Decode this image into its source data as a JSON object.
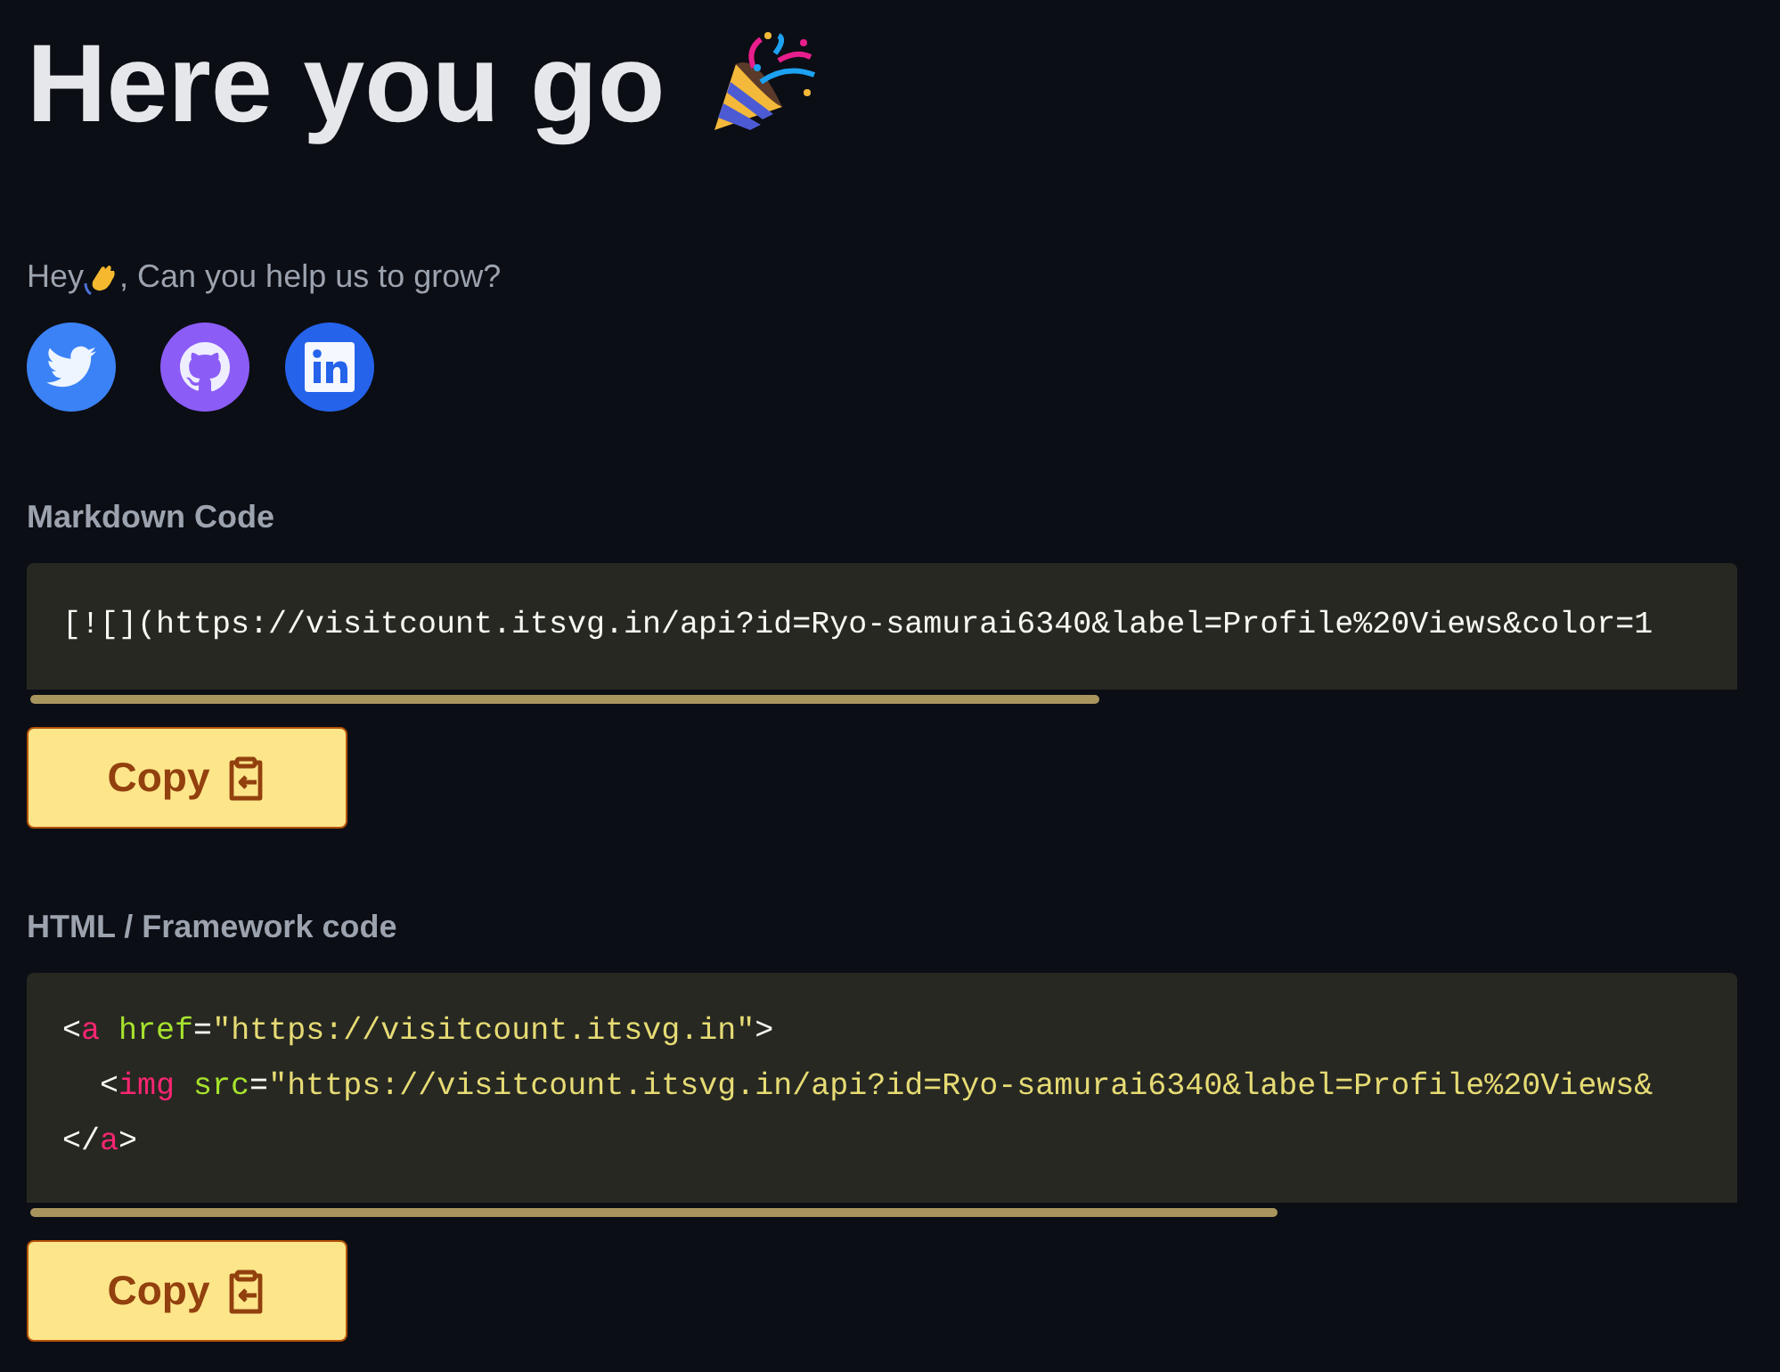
{
  "title": "Here you go",
  "invite": {
    "greeting": "Hey",
    "question": ", Can you help us to grow?"
  },
  "social": [
    {
      "kind": "twitter",
      "color": "#3b82f6"
    },
    {
      "kind": "github",
      "color": "#8b5cf6"
    },
    {
      "kind": "linkedin",
      "color": "#2563eb"
    }
  ],
  "sections": [
    {
      "label": "Markdown Code",
      "lines": [
        [
          {
            "kind": "text",
            "text": "[![](https://visitcount.itsvg.in/api?id=Ryo-samurai6340&label=Profile%20Views&color=1"
          }
        ]
      ],
      "button": "Copy"
    },
    {
      "label": "HTML / Framework code",
      "lines": [
        [
          {
            "kind": "punct",
            "text": "<"
          },
          {
            "kind": "tag",
            "text": "a"
          },
          {
            "kind": "attr",
            "text": " href"
          },
          {
            "kind": "punct",
            "text": "="
          },
          {
            "kind": "string",
            "text": "\"https://visitcount.itsvg.in\""
          },
          {
            "kind": "punct",
            "text": ">"
          }
        ],
        [
          {
            "kind": "punct",
            "text": "  <"
          },
          {
            "kind": "tag",
            "text": "img"
          },
          {
            "kind": "attr",
            "text": " src"
          },
          {
            "kind": "punct",
            "text": "="
          },
          {
            "kind": "string",
            "text": "\"https://visitcount.itsvg.in/api?id=Ryo-samurai6340&label=Profile%20Views&"
          }
        ],
        [
          {
            "kind": "punct",
            "text": "</"
          },
          {
            "kind": "tag",
            "text": "a"
          },
          {
            "kind": "punct",
            "text": ">"
          }
        ]
      ],
      "button": "Copy"
    }
  ]
}
